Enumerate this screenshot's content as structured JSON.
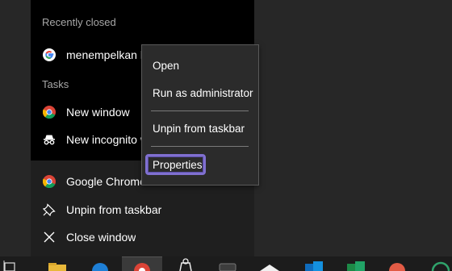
{
  "jumplist": {
    "recently_closed_heading": "Recently closed",
    "recent_items": [
      {
        "label": "menempelkan li",
        "icon": "google-g-icon"
      }
    ],
    "tasks_heading": "Tasks",
    "tasks": [
      {
        "label": "New window",
        "icon": "chrome-icon"
      },
      {
        "label": "New incognito w",
        "icon": "incognito-icon"
      }
    ],
    "app_actions": [
      {
        "label": "Google Chrome",
        "icon": "chrome-icon"
      },
      {
        "label": "Unpin from taskbar",
        "icon": "unpin-icon"
      },
      {
        "label": "Close window",
        "icon": "close-icon"
      }
    ]
  },
  "context_menu": {
    "items": [
      "Open",
      "Run as administrator",
      "Unpin from taskbar",
      "Properties"
    ],
    "highlighted": "Properties",
    "highlight_color": "#8070d0"
  },
  "taskbar": {
    "icons": [
      "task-view-icon",
      "file-explorer-icon",
      "edge-icon",
      "chrome-icon",
      "store-icon",
      "app-icon",
      "mail-icon",
      "outlook-icon",
      "excel-icon",
      "app-icon",
      "app-icon"
    ]
  }
}
